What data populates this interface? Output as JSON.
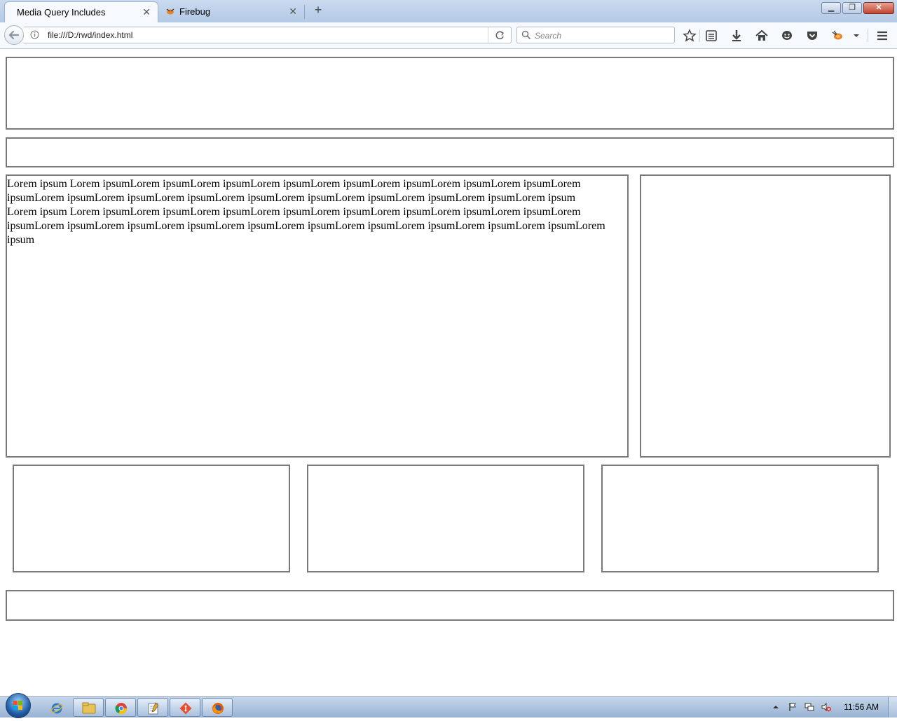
{
  "browser": {
    "tabs": [
      {
        "title": "Media Query Includes",
        "active": true,
        "close": "✕"
      },
      {
        "title": "Firebug",
        "active": false,
        "close": "✕"
      }
    ],
    "new_tab_icon": "+",
    "url": "file:///D:/rwd/index.html",
    "search_placeholder": "Search",
    "toolbar_icons": [
      "star-icon",
      "reading-list-icon",
      "download-icon",
      "home-icon",
      "chat-icon",
      "pocket-icon",
      "firebug-icon",
      "dropdown-icon",
      "menu-icon"
    ],
    "window_buttons": [
      "minimize",
      "restore",
      "close"
    ]
  },
  "page": {
    "main_text": [
      "Lorem ipsum Lorem ipsumLorem ipsumLorem ipsumLorem ipsumLorem ipsumLorem ipsumLorem ipsumLorem ipsumLorem ipsumLorem ipsumLorem ipsumLorem ipsumLorem ipsumLorem ipsumLorem ipsumLorem ipsumLorem ipsumLorem ipsum",
      "Lorem ipsum Lorem ipsumLorem ipsumLorem ipsumLorem ipsumLorem ipsumLorem ipsumLorem ipsumLorem ipsumLorem ipsumLorem ipsumLorem ipsumLorem ipsumLorem ipsumLorem ipsumLorem ipsumLorem ipsumLorem ipsumLorem ipsumLorem ipsum"
    ]
  },
  "taskbar": {
    "pinned": [
      "start-orb",
      "internet-explorer-icon",
      "file-explorer-icon",
      "chrome-icon",
      "notepad-icon",
      "git-icon",
      "firefox-icon"
    ],
    "clock": "11:56 AM"
  },
  "colors": {
    "box_border": "#7a7a7a",
    "tab_strip": "#b4c9e6"
  }
}
